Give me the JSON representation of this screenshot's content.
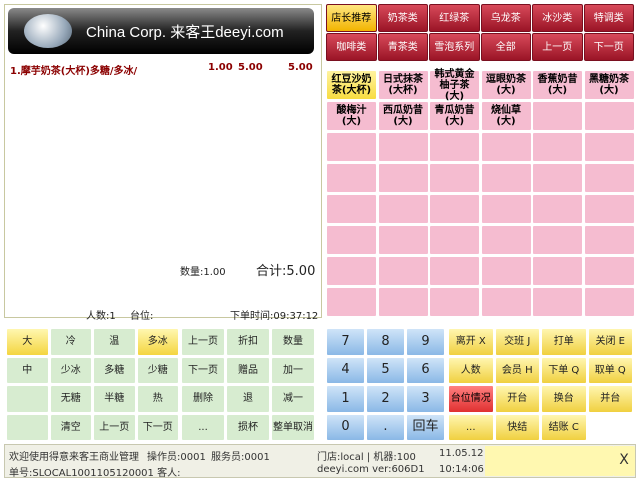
{
  "header": {
    "title": "China Corp. 来客王deeyi.com"
  },
  "order": {
    "item": "1.摩芋奶茶(大杯)多糖/多冰/",
    "qty": "1.00",
    "price": "5.00",
    "amount": "5.00",
    "count_label": "数量:",
    "count": "1.00",
    "total_label": "合计:",
    "total": "5.00",
    "people_label": "人数:",
    "people": "1",
    "table_label": "台位:",
    "time_label": "下单时间:",
    "time": "09:37:12"
  },
  "categories": [
    "店长推荐",
    "奶茶类",
    "红绿茶",
    "乌龙茶",
    "冰沙类",
    "特调类",
    "咖啡类",
    "青茶类",
    "雪泡系列",
    "全部",
    "上一页",
    "下一页"
  ],
  "products": [
    "红豆沙奶茶(大杯)",
    "日式抹茶(大杯)",
    "韩式黄金柚子茶(大)",
    "逗眼奶茶(大)",
    "香蕉奶昔(大)",
    "黑糖奶茶(大)",
    "酸梅汁(大)",
    "西瓜奶昔(大)",
    "青瓜奶昔(大)",
    "烧仙草(大)"
  ],
  "modifiers": [
    "大",
    "冷",
    "温",
    "多冰",
    "中",
    "少冰",
    "多糖",
    "少糖",
    "",
    "无糖",
    "半糖",
    "热",
    "",
    "清空",
    "上一页",
    "下一页"
  ],
  "ops": [
    "上一页",
    "折扣",
    "数量",
    "下一页",
    "赠品",
    "加一",
    "删除",
    "退",
    "减一",
    "...",
    "损杯",
    "整单取消"
  ],
  "keypad": [
    "7",
    "8",
    "9",
    "4",
    "5",
    "6",
    "1",
    "2",
    "3",
    "0",
    ".",
    "回车"
  ],
  "functions": [
    "离开 X",
    "交班 J",
    "打单",
    "关闭 E",
    "人数",
    "会员 H",
    "下单 Q",
    "取单 Q",
    "台位情况",
    "开台",
    "换台",
    "并台",
    "...",
    "快结",
    "结账 C"
  ],
  "status": {
    "welcome": "欢迎使用得意来客王商业管理",
    "operator": "操作员:0001",
    "server": "服务员:0001",
    "store": "门店:local | 机器:100",
    "order_no": "单号:SLOCAL1001105120001 客人:",
    "site": "deeyi.com ver:606D1",
    "date": "11.05.12",
    "time": "10:14:06",
    "close": "X"
  },
  "colors": {
    "category": "#b0202e",
    "selected": "#f2c400",
    "product": "#f5bcd0"
  }
}
